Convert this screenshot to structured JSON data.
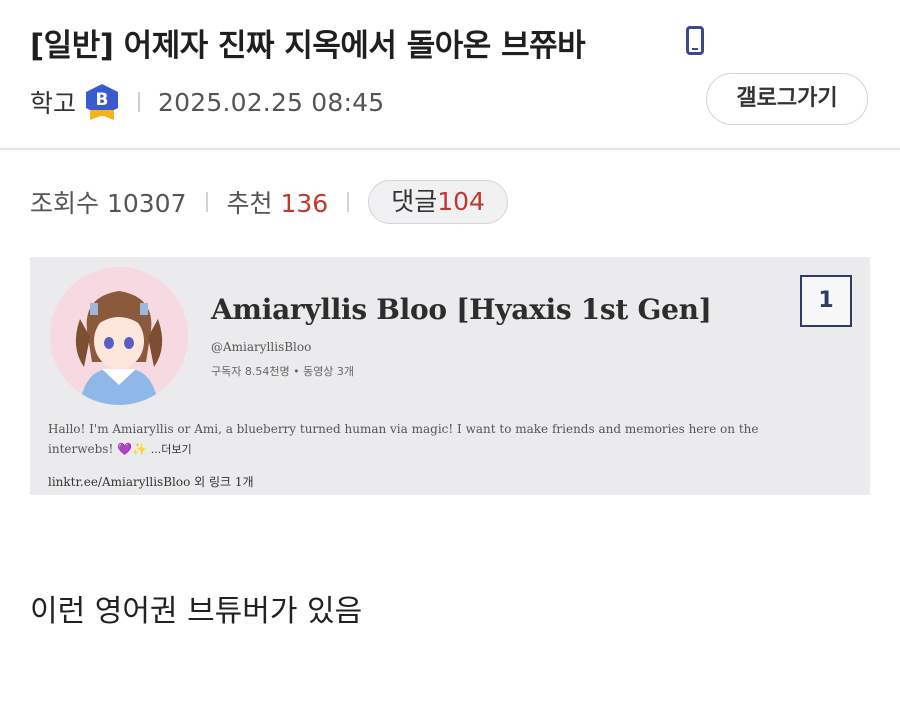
{
  "post": {
    "title": "[일반] 어제자 진짜 지옥에서 돌아온 브쮸바",
    "author": "학고",
    "author_badge": "B",
    "date": "2025.02.25 08:45",
    "gallery_button": "갤로그가기"
  },
  "stats": {
    "views_label": "조회수",
    "views": "10307",
    "recommend_label": "추천",
    "recommend": "136",
    "comments_label": "댓글",
    "comments": "104"
  },
  "embed": {
    "channel_name": "Amiaryllis Bloo [Hyaxis 1st Gen]",
    "handle": "@AmiaryllisBloo",
    "subs": "구독자 8.54천명 • 동영상 3개",
    "description": "Hallo! I'm Amiaryllis or Ami, a blueberry turned human via magic! I want to make friends and memories here on the interwebs! 💜✨",
    "description_more": "...더보기",
    "link": "linktr.ee/AmiaryllisBloo 외 링크 1개",
    "rank": "1"
  },
  "body": {
    "text": "이런 영어권 브튜버가 있음"
  },
  "colors": {
    "accent_red": "#c0392b",
    "badge_blue": "#3a5bd0",
    "mobile_icon": "#3c4a8c"
  }
}
